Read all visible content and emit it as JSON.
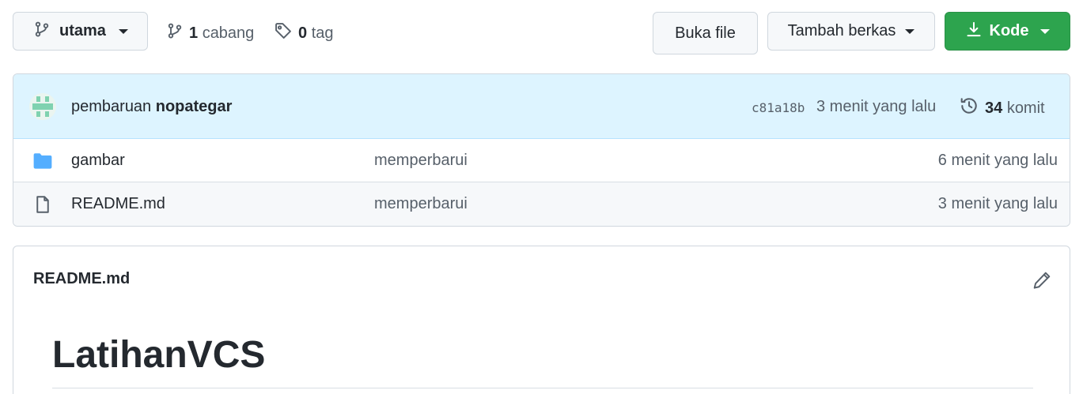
{
  "toolbar": {
    "branch_name": "utama",
    "branch_count": "1",
    "branch_label": "cabang",
    "tag_count": "0",
    "tag_label": "tag",
    "open_file_label": "Buka file",
    "add_file_label": "Tambah berkas",
    "code_label": "Kode",
    "code_color": "#2da44e"
  },
  "commit": {
    "message": "pembaruan",
    "author": "nopategar",
    "sha": "c81a18b",
    "time": "3 menit yang lalu",
    "count": "34",
    "count_label": "komit",
    "bar_color": "#ddf4ff"
  },
  "files": [
    {
      "icon": "folder-icon",
      "name": "gambar",
      "message": "memperbarui",
      "time": "6 menit yang lalu"
    },
    {
      "icon": "file-icon",
      "name": "README.md",
      "message": "memperbarui",
      "time": "3 menit yang lalu"
    }
  ],
  "readme": {
    "filename": "README.md",
    "heading": "LatihanVCS"
  }
}
